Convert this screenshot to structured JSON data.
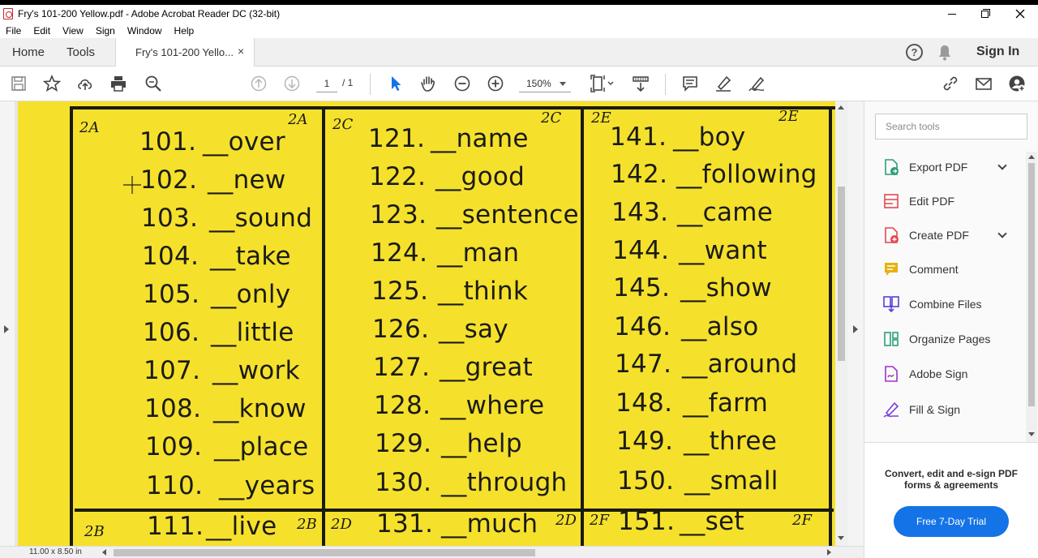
{
  "window": {
    "title": "Fry's 101-200 Yellow.pdf - Adobe Acrobat Reader DC (32-bit)"
  },
  "menu": [
    "File",
    "Edit",
    "View",
    "Sign",
    "Window",
    "Help"
  ],
  "tabs": {
    "home": "Home",
    "tools": "Tools",
    "document": "Fry's 101-200 Yello...",
    "close": "×",
    "sign_in": "Sign In"
  },
  "toolbar": {
    "page_current": "1",
    "page_total": "/ 1",
    "zoom": "150%"
  },
  "document": {
    "page_size": "11.00 x 8.50 in",
    "codes": {
      "a_left": "2A",
      "a_right": "2A",
      "c_left": "2C",
      "c_right": "2C",
      "e_left": "2E",
      "e_right": "2E",
      "b_left": "2B",
      "b_right": "2B",
      "d_left": "2D",
      "d_right": "2D",
      "f_left": "2F",
      "f_right": "2F"
    },
    "columns": [
      {
        "rows": [
          {
            "num": "101.",
            "word": "__over"
          },
          {
            "num": "102.",
            "word": "__new"
          },
          {
            "num": "103.",
            "word": "__sound"
          },
          {
            "num": "104.",
            "word": "__take"
          },
          {
            "num": "105.",
            "word": "__only"
          },
          {
            "num": "106.",
            "word": "__little"
          },
          {
            "num": "107.",
            "word": "__work"
          },
          {
            "num": "108.",
            "word": "__know"
          },
          {
            "num": "109.",
            "word": "__place"
          },
          {
            "num": "110.",
            "word": "__years"
          }
        ],
        "next": {
          "num": "111.",
          "word": "__live"
        }
      },
      {
        "rows": [
          {
            "num": "121.",
            "word": "__name"
          },
          {
            "num": "122.",
            "word": "__good"
          },
          {
            "num": "123.",
            "word": "__sentence"
          },
          {
            "num": "124.",
            "word": "__man"
          },
          {
            "num": "125.",
            "word": "__think"
          },
          {
            "num": "126.",
            "word": "__say"
          },
          {
            "num": "127.",
            "word": "__great"
          },
          {
            "num": "128.",
            "word": "__where"
          },
          {
            "num": "129.",
            "word": "__help"
          },
          {
            "num": "130.",
            "word": "__through"
          }
        ],
        "next": {
          "num": "131.",
          "word": "__much"
        }
      },
      {
        "rows": [
          {
            "num": "141.",
            "word": "__boy"
          },
          {
            "num": "142.",
            "word": "__following"
          },
          {
            "num": "143.",
            "word": "__came"
          },
          {
            "num": "144.",
            "word": "__want"
          },
          {
            "num": "145.",
            "word": "__show"
          },
          {
            "num": "146.",
            "word": "__also"
          },
          {
            "num": "147.",
            "word": "__around"
          },
          {
            "num": "148.",
            "word": "__farm"
          },
          {
            "num": "149.",
            "word": "__three"
          },
          {
            "num": "150.",
            "word": "__small"
          }
        ],
        "next": {
          "num": "151.",
          "word": "__set"
        }
      }
    ]
  },
  "side_panel": {
    "search_placeholder": "Search tools",
    "tools": [
      {
        "label": "Export PDF",
        "icon": "export-pdf-icon",
        "color": "#2d9d78",
        "expandable": true
      },
      {
        "label": "Edit PDF",
        "icon": "edit-pdf-icon",
        "color": "#e34850",
        "expandable": false
      },
      {
        "label": "Create PDF",
        "icon": "create-pdf-icon",
        "color": "#e34850",
        "expandable": true
      },
      {
        "label": "Comment",
        "icon": "comment-icon",
        "color": "#e8b10e",
        "expandable": false
      },
      {
        "label": "Combine Files",
        "icon": "combine-files-icon",
        "color": "#5a3fd6",
        "expandable": false
      },
      {
        "label": "Organize Pages",
        "icon": "organize-pages-icon",
        "color": "#2d9d78",
        "expandable": false
      },
      {
        "label": "Adobe Sign",
        "icon": "adobe-sign-icon",
        "color": "#9b35c9",
        "expandable": false
      },
      {
        "label": "Fill & Sign",
        "icon": "fill-sign-icon",
        "color": "#7a3fd6",
        "expandable": false
      }
    ],
    "promo_text": "Convert, edit and e-sign PDF forms & agreements",
    "promo_button": "Free 7-Day Trial"
  },
  "colors": {
    "page_yellow": "#f5e12c",
    "accent_blue": "#1473e6",
    "select_tool_blue": "#1473e6"
  }
}
